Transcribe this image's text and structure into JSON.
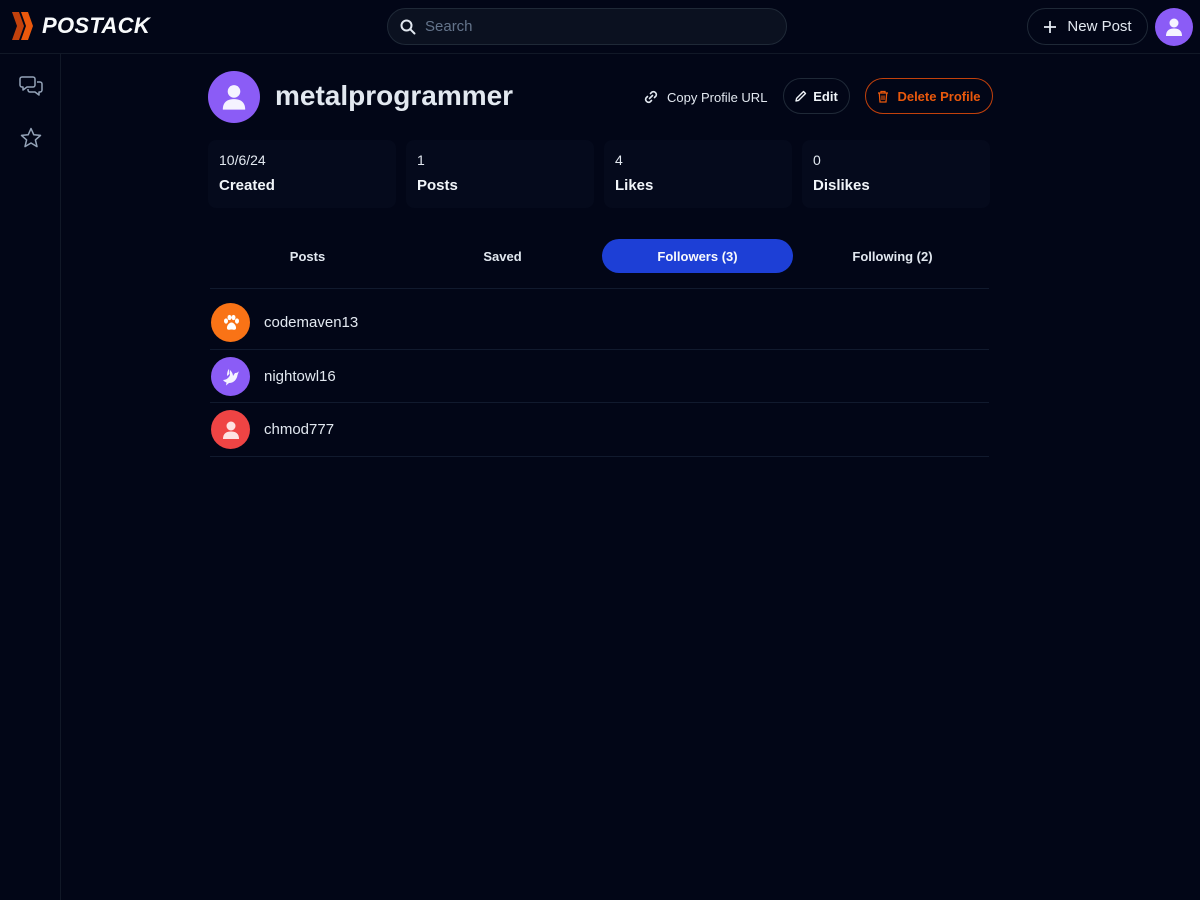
{
  "app": {
    "name": "POSTACK",
    "brand_color": "#c2410c"
  },
  "search": {
    "placeholder": "Search"
  },
  "header": {
    "new_post_label": "New Post"
  },
  "sidebar": {
    "items": [
      {
        "icon": "chat-bubbles-icon"
      },
      {
        "icon": "star-icon"
      }
    ]
  },
  "profile": {
    "username": "metalprogrammer",
    "copy_url_label": "Copy Profile URL",
    "edit_label": "Edit",
    "delete_label": "Delete Profile",
    "avatar_color": "#8b5cf6"
  },
  "stats": [
    {
      "value": "10/6/24",
      "label": "Created"
    },
    {
      "value": "1",
      "label": "Posts"
    },
    {
      "value": "4",
      "label": "Likes"
    },
    {
      "value": "0",
      "label": "Dislikes"
    }
  ],
  "tabs": [
    {
      "label": "Posts",
      "active": false
    },
    {
      "label": "Saved",
      "active": false
    },
    {
      "label": "Followers (3)",
      "active": true
    },
    {
      "label": "Following (2)",
      "active": false
    }
  ],
  "followers": [
    {
      "name": "codemaven13",
      "icon": "paw-icon",
      "color": "#f97316"
    },
    {
      "name": "nightowl16",
      "icon": "dove-icon",
      "color": "#8b5cf6"
    },
    {
      "name": "chmod777",
      "icon": "user-icon",
      "color": "#ef4444"
    }
  ]
}
